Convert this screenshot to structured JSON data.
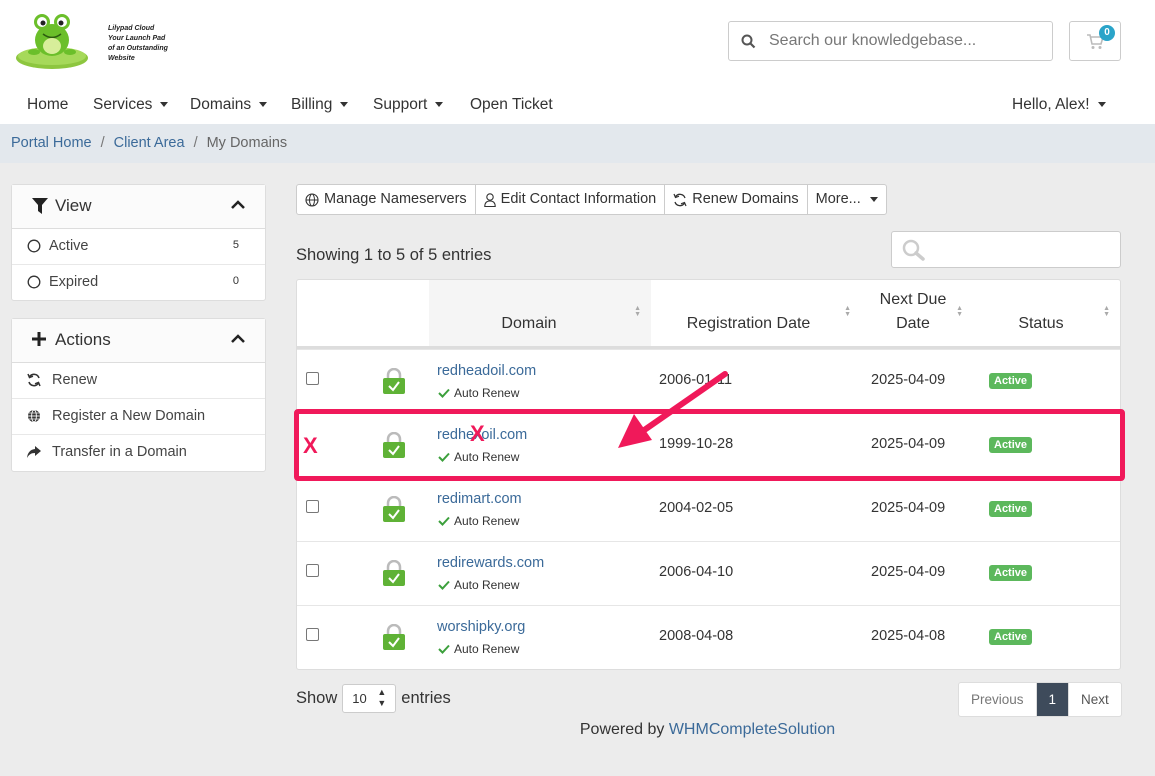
{
  "header": {
    "logo_text": "Lilypad Cloud Your Launch Pad of an Outstanding Website",
    "search_placeholder": "Search our knowledgebase...",
    "cart_count": "0"
  },
  "nav": {
    "items": [
      {
        "label": "Home"
      },
      {
        "label": "Services"
      },
      {
        "label": "Domains"
      },
      {
        "label": "Billing"
      },
      {
        "label": "Support"
      },
      {
        "label": "Open Ticket"
      }
    ],
    "user": "Hello, Alex!"
  },
  "breadcrumb": {
    "items": [
      "Portal Home",
      "Client Area"
    ],
    "active": "My Domains",
    "sep": "/"
  },
  "sidebar": {
    "view": {
      "title": "View",
      "items": [
        {
          "label": "Active",
          "count": "5"
        },
        {
          "label": "Expired",
          "count": "0"
        }
      ]
    },
    "actions": {
      "title": "Actions",
      "items": [
        {
          "label": "Renew",
          "icon": "refresh-icon"
        },
        {
          "label": "Register a New Domain",
          "icon": "globe-icon"
        },
        {
          "label": "Transfer in a Domain",
          "icon": "share-arrow-icon"
        }
      ]
    }
  },
  "toolbar": {
    "manage_ns": "Manage Nameservers",
    "edit_contact": "Edit Contact Information",
    "renew": "Renew Domains",
    "more": "More..."
  },
  "table": {
    "showing": "Showing 1 to 5 of 5 entries",
    "headers": {
      "domain": "Domain",
      "reg_date": "Registration Date",
      "next_due_1": "Next Due",
      "next_due_2": "Date",
      "status": "Status"
    },
    "rows": [
      {
        "domain": "redheadoil.com",
        "auto": "Auto Renew",
        "reg": "2006-01-11",
        "due": "2025-04-09",
        "status": "Active"
      },
      {
        "domain": "redhexoil.com",
        "auto": "Auto Renew",
        "reg": "1999-10-28",
        "due": "2025-04-09",
        "status": "Active"
      },
      {
        "domain": "redimart.com",
        "auto": "Auto Renew",
        "reg": "2004-02-05",
        "due": "2025-04-09",
        "status": "Active"
      },
      {
        "domain": "redirewards.com",
        "auto": "Auto Renew",
        "reg": "2006-04-10",
        "due": "2025-04-09",
        "status": "Active"
      },
      {
        "domain": "worshipky.org",
        "auto": "Auto Renew",
        "reg": "2008-04-08",
        "due": "2025-04-08",
        "status": "Active"
      }
    ]
  },
  "annotations": {
    "x_mark": "X"
  },
  "footer_controls": {
    "show": "Show",
    "per_page": "10",
    "entries": "entries",
    "previous": "Previous",
    "page": "1",
    "next": "Next"
  },
  "footer": {
    "powered_by": "Powered by",
    "link": "WHMCompleteSolution"
  },
  "colors": {
    "link": "#3b6a99",
    "status_active": "#5cb85c",
    "highlight": "#f0195a",
    "badge": "#2aa4c9"
  }
}
